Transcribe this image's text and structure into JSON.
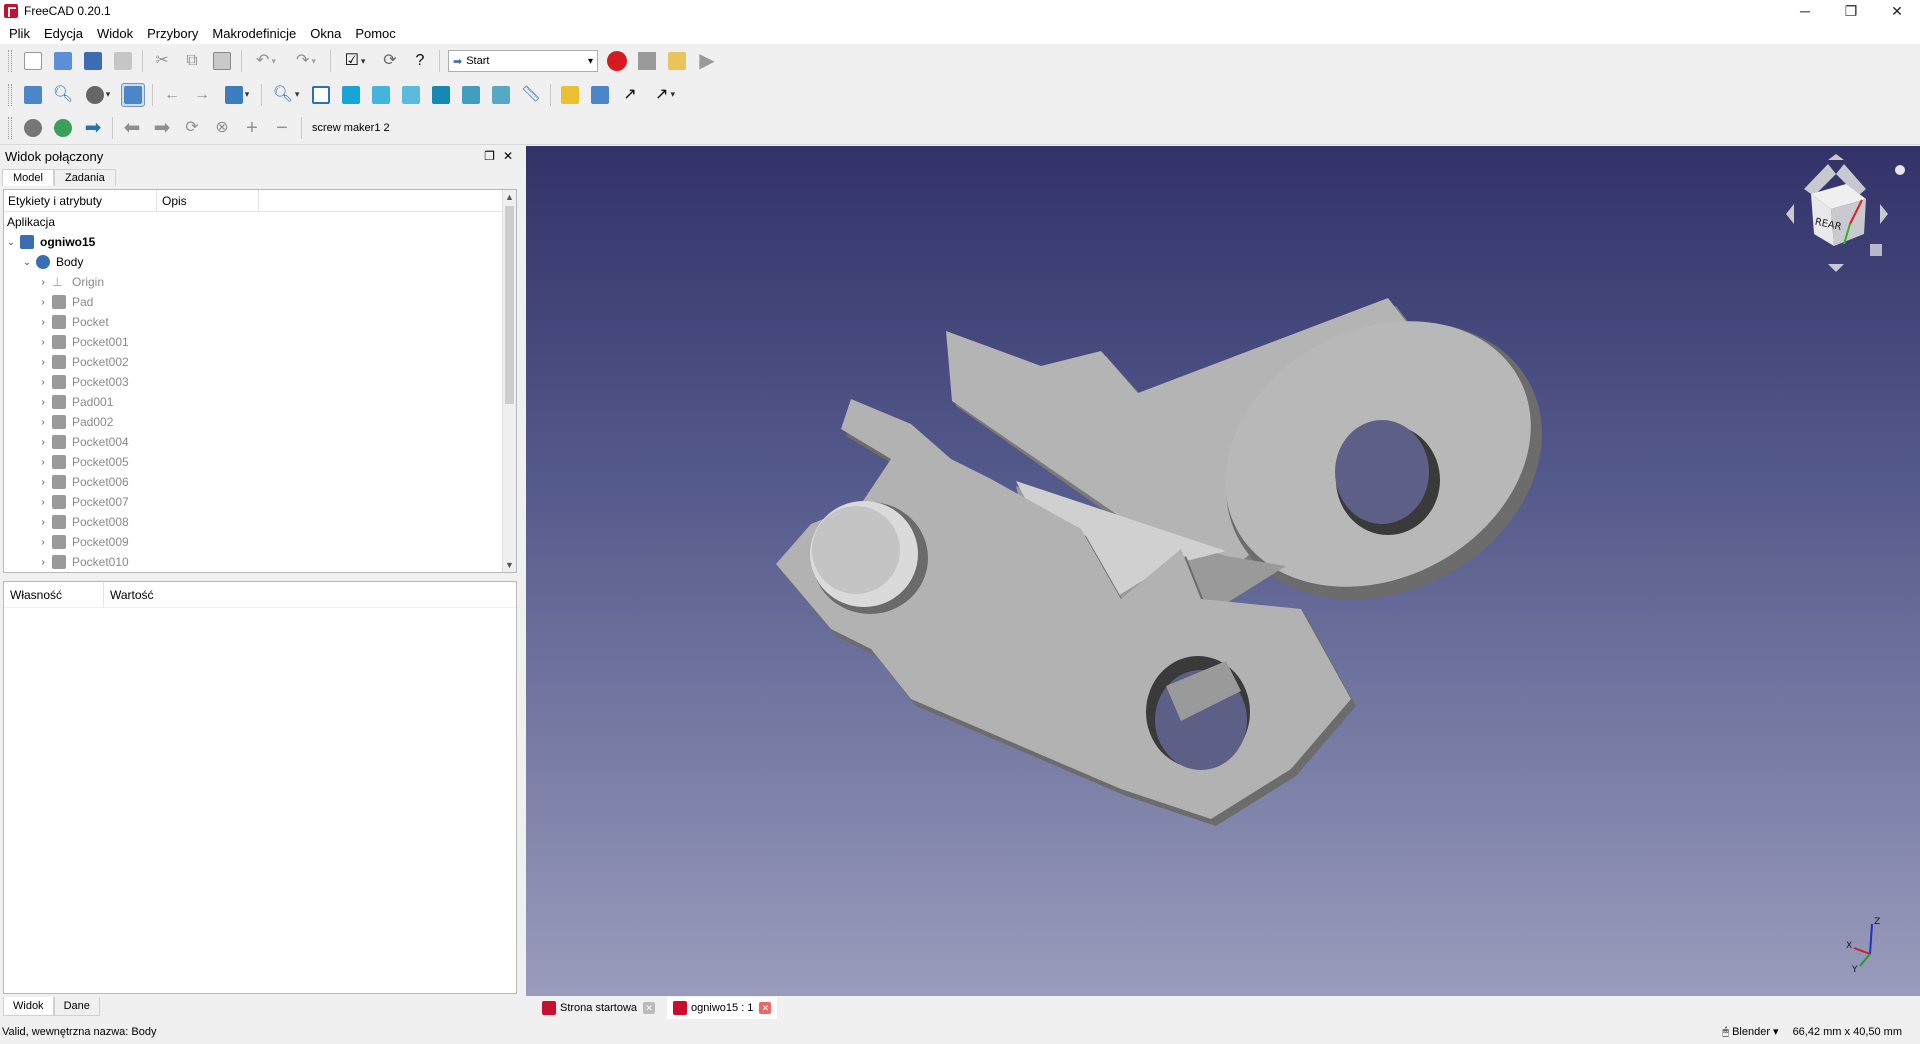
{
  "window": {
    "title": "FreeCAD 0.20.1",
    "minimize": "─",
    "maximize": "❐",
    "close": "✕"
  },
  "menu": [
    "Plik",
    "Edycja",
    "Widok",
    "Przybory",
    "Makrodefinicje",
    "Okna",
    "Pomoc"
  ],
  "toolbar": {
    "workbench": "Start",
    "macro_label": "screw maker1 2"
  },
  "combo_view": {
    "title": "Widok połączony",
    "tabs": {
      "model": "Model",
      "tasks": "Zadania"
    },
    "tree_columns": {
      "labels": "Etykiety i atrybuty",
      "description": "Opis"
    },
    "app_label": "Aplikacja",
    "document": "ogniwo15",
    "body": "Body",
    "features": [
      "Origin",
      "Pad",
      "Pocket",
      "Pocket001",
      "Pocket002",
      "Pocket003",
      "Pad001",
      "Pad002",
      "Pocket004",
      "Pocket005",
      "Pocket006",
      "Pocket007",
      "Pocket008",
      "Pocket009",
      "Pocket010"
    ],
    "property_columns": {
      "property": "Własność",
      "value": "Wartość"
    },
    "bottom_tabs": {
      "view": "Widok",
      "data": "Dane"
    }
  },
  "viewport": {
    "navcube_face": "REAR",
    "axes": {
      "x": "X",
      "y": "Y",
      "z": "Z"
    },
    "colors": {
      "top": "#323268",
      "bottom": "#9a9cbc",
      "part": "#b4b4b4"
    }
  },
  "doc_tabs": [
    {
      "label": "Strona startowa",
      "active": false
    },
    {
      "label": "ogniwo15 : 1",
      "active": true
    }
  ],
  "status": {
    "message": "Valid, wewnętrzna nazwa: Body",
    "nav_style": "Blender",
    "dimensions": "66,42 mm x 40,50 mm"
  }
}
